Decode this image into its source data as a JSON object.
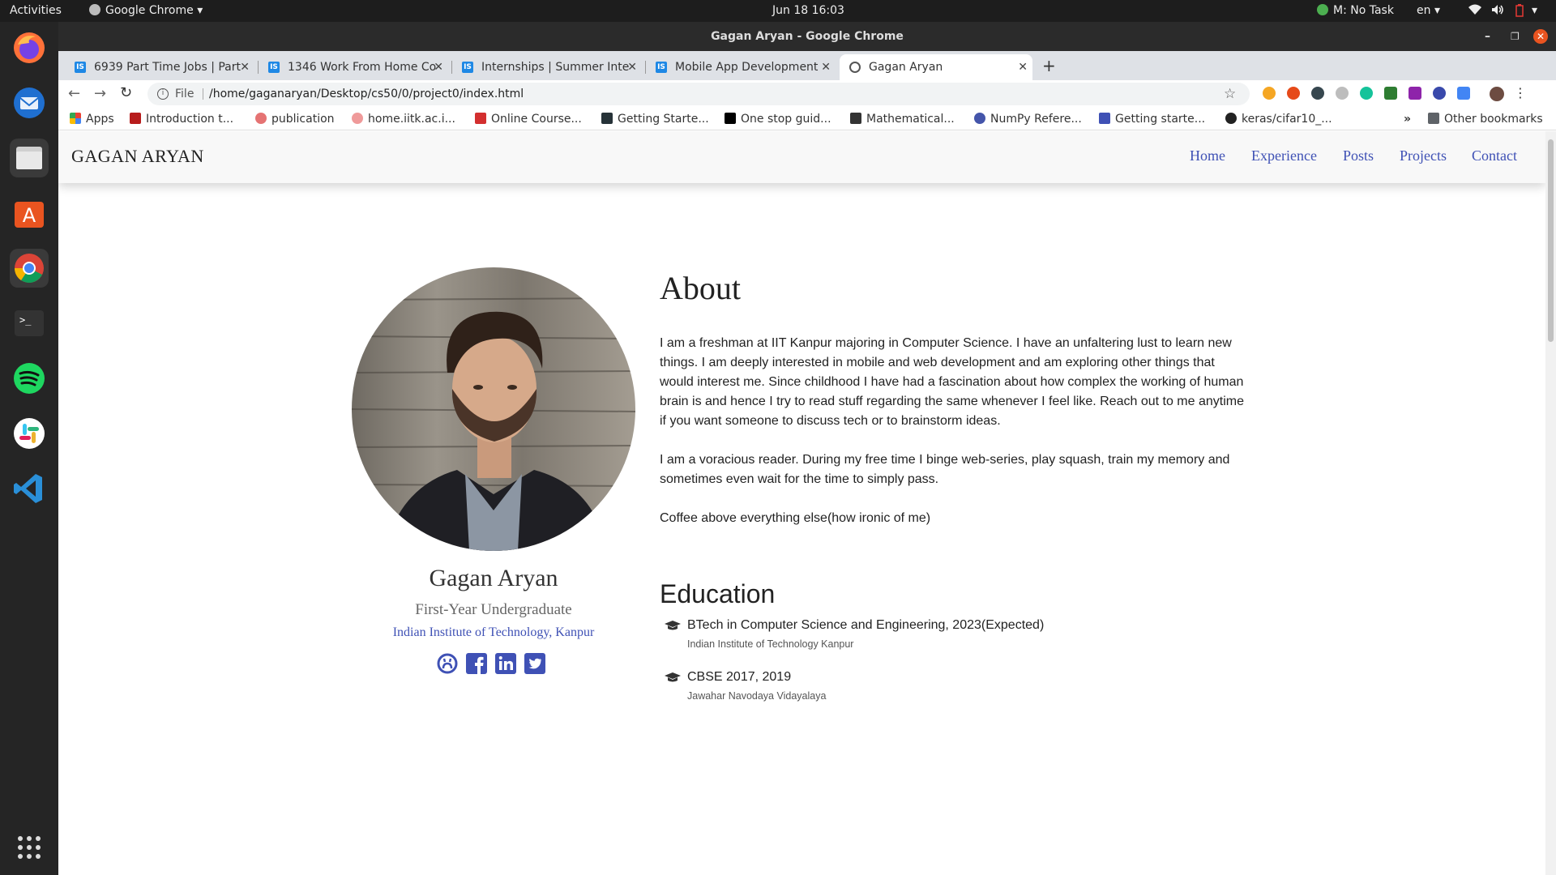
{
  "system_bar": {
    "activities": "Activities",
    "app_name": "Google Chrome",
    "datetime": "Jun 18  16:03",
    "task": "M: No Task",
    "lang": "en"
  },
  "window": {
    "title": "Gagan Aryan - Google Chrome"
  },
  "tabs": [
    {
      "label": "6939 Part Time Jobs | Part",
      "favicon": "IS"
    },
    {
      "label": "1346 Work From Home Co",
      "favicon": "IS"
    },
    {
      "label": "Internships | Summer Inte",
      "favicon": "IS"
    },
    {
      "label": "Mobile App Development",
      "favicon": "IS"
    },
    {
      "label": "Gagan Aryan",
      "favicon": "globe"
    }
  ],
  "address": {
    "scheme": "File",
    "url": "/home/gaganaryan/Desktop/cs50/0/project0/index.html"
  },
  "bookmarks": [
    "Apps",
    "Introduction t...",
    "publication",
    "home.iitk.ac.i...",
    "Online Course...",
    "Getting Starte...",
    "One stop guid...",
    "Mathematical...",
    "NumPy Refere...",
    "Getting starte...",
    "keras/cifar10_...",
    "Other bookmarks"
  ],
  "site": {
    "brand": "GAGAN ARYAN",
    "nav": [
      "Home",
      "Experience",
      "Posts",
      "Projects",
      "Contact"
    ],
    "profile": {
      "name": "Gagan Aryan",
      "role": "First-Year Undergraduate",
      "institution": "Indian Institute of Technology, Kanpur"
    },
    "about": {
      "heading": "About",
      "paragraphs": [
        "I am a freshman at IIT Kanpur majoring in Computer Science. I have an unfaltering lust to learn new things. I am deeply interested in mobile and web development and am exploring other things that would interest me. Since childhood I have had a fascination about how complex the working of human brain is and hence I try to read stuff regarding the same whenever I feel like. Reach out to me anytime if you want someone to discuss tech or to brainstorm ideas.",
        "I am a voracious reader. During my free time I binge web-series, play squash, train my memory and sometimes even wait for the time to simply pass.",
        "Coffee above everything else(how ironic of me)"
      ]
    },
    "education": {
      "heading": "Education",
      "items": [
        {
          "title": "BTech in Computer Science and Engineering, 2023(Expected)",
          "school": "Indian Institute of Technology Kanpur"
        },
        {
          "title": "CBSE 2017, 2019",
          "school": "Jawahar Navodaya Vidayalaya"
        }
      ]
    },
    "link_color": "#3f51b5"
  }
}
